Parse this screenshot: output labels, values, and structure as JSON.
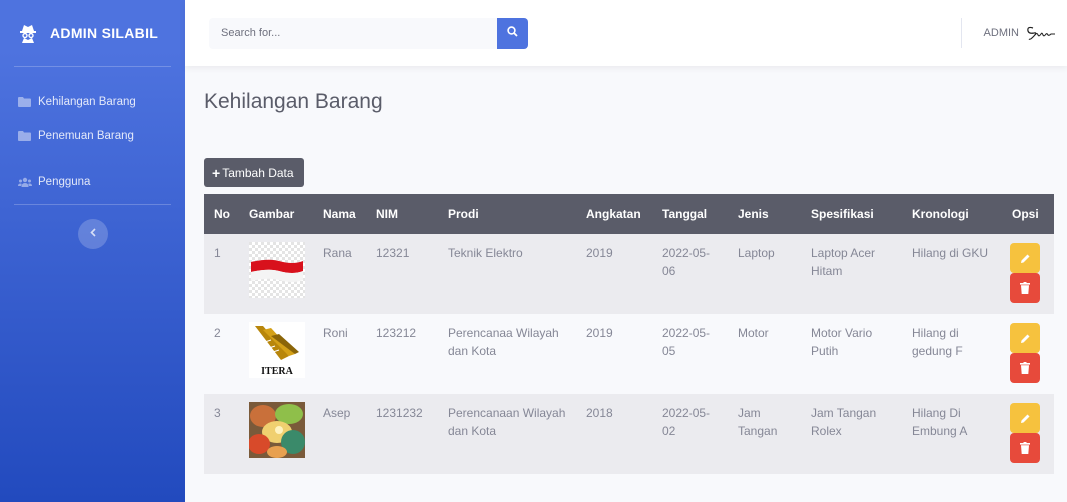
{
  "sidebar": {
    "brand": "ADMIN SILABIL",
    "items": [
      {
        "label": "Kehilangan Barang",
        "icon": "folder-icon"
      },
      {
        "label": "Penemuan Barang",
        "icon": "folder-icon"
      },
      {
        "label": "Pengguna",
        "icon": "users-icon"
      }
    ],
    "toggle_icon": "chevron-left-icon"
  },
  "topbar": {
    "search_placeholder": "Search for...",
    "search_icon": "search-icon",
    "user_name": "ADMIN"
  },
  "page": {
    "title": "Kehilangan Barang",
    "add_button": "Tambah Data"
  },
  "table": {
    "headers": [
      "No",
      "Gambar",
      "Nama",
      "NIM",
      "Prodi",
      "Angkatan",
      "Tanggal",
      "Jenis",
      "Spesifikasi",
      "Kronologi",
      "Opsi"
    ],
    "rows": [
      {
        "no": "1",
        "image": "indonesian-flag",
        "nama": "Rana",
        "nim": "12321",
        "prodi": "Teknik Elektro",
        "angkatan": "2019",
        "tanggal": "2022-05-06",
        "jenis": "Laptop",
        "spesifikasi": "Laptop Acer Hitam",
        "kronologi": "Hilang di GKU"
      },
      {
        "no": "2",
        "image": "itera-logo",
        "image_text": "ITERA",
        "nama": "Roni",
        "nim": "123212",
        "prodi": "Perencanaa Wilayah dan Kota",
        "angkatan": "2019",
        "tanggal": "2022-05-05",
        "jenis": "Motor",
        "spesifikasi": "Motor Vario Putih",
        "kronologi": "Hilang di gedung F"
      },
      {
        "no": "3",
        "image": "food-photo",
        "nama": "Asep",
        "nim": "1231232",
        "prodi": "Perencanaan Wilayah dan Kota",
        "angkatan": "2018",
        "tanggal": "2022-05-02",
        "jenis": "Jam Tangan",
        "spesifikasi": "Jam Tangan Rolex",
        "kronologi": "Hilang Di Embung A"
      }
    ]
  },
  "colors": {
    "primary": "#4e73df",
    "dark": "#5a5c69",
    "warning": "#f6c23e",
    "danger": "#e74a3b"
  }
}
